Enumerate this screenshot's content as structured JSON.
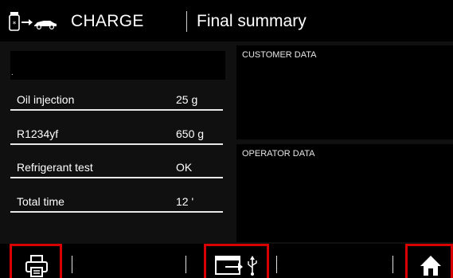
{
  "header": {
    "mode_icon": "vehicle-charge-icon",
    "mode": "CHARGE",
    "title": "Final summary"
  },
  "summary": {
    "blank_field_text": ".",
    "rows": [
      {
        "label": "Oil injection",
        "value": "25  g"
      },
      {
        "label": "R1234yf",
        "value": "650 g"
      },
      {
        "label": "Refrigerant test",
        "value": "OK"
      },
      {
        "label": "Total time",
        "value": "12 '"
      }
    ]
  },
  "customer": {
    "title": "CUSTOMER DATA"
  },
  "operator": {
    "title": "OPERATOR DATA"
  },
  "toolbar": {
    "buttons": [
      {
        "icon": "printer-icon"
      },
      {
        "icon": "export-usb-icon"
      },
      {
        "icon": "home-icon"
      }
    ],
    "accent_color": "#d80000"
  }
}
